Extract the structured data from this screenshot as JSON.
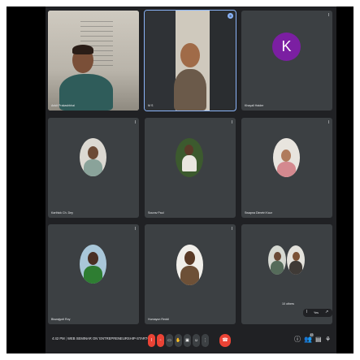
{
  "meeting": {
    "time": "4:42 PM",
    "title": "WEB SEMINAR ON 'ENTREPRENEURSHIP-START-UP...",
    "participants_badge": "12"
  },
  "participants": [
    {
      "name": "Ankit Prakashbhai",
      "muted": false,
      "video": true
    },
    {
      "name": "M S",
      "muted": false,
      "video": true,
      "speaking": true
    },
    {
      "name": "Khayali Haider",
      "initial": "K",
      "muted": true,
      "video": false,
      "avatar_color": "#7b1fa2"
    },
    {
      "name": "Karthick Ch. Dey",
      "muted": true,
      "video": false
    },
    {
      "name": "Sourav Paul",
      "muted": true,
      "video": false
    },
    {
      "name": "Swapna Dimetri Kaur",
      "muted": true,
      "video": false
    },
    {
      "name": "Biswajyoti Roy",
      "muted": true,
      "video": false
    },
    {
      "name": "Humayun Reddi",
      "muted": true,
      "video": false
    }
  ],
  "others_tile": {
    "label": "10 others",
    "controls": [
      "mic-off",
      "Yes",
      "expand"
    ]
  },
  "icons": {
    "mic_off": "mic-off-icon",
    "speaking": "audio-wave-icon",
    "hangup": "phone-hangup-icon"
  },
  "colors": {
    "background": "#202124",
    "tile": "#3c4043",
    "danger": "#ea4335",
    "accent": "#8ab4f8"
  }
}
